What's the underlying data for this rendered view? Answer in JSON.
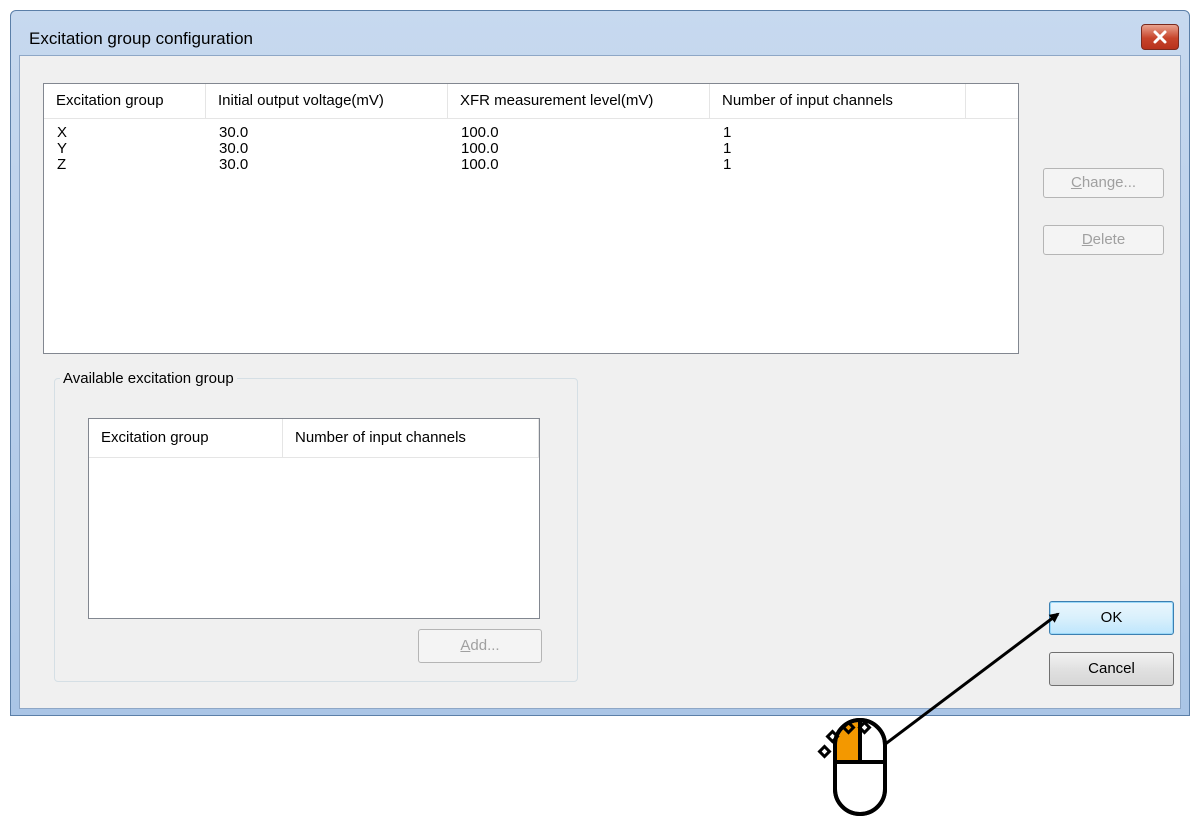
{
  "window": {
    "title": "Excitation group configuration"
  },
  "config_list": {
    "columns": [
      "Excitation group",
      "Initial output voltage(mV)",
      "XFR measurement level(mV)",
      "Number of input channels"
    ],
    "rows": [
      [
        "X",
        "30.0",
        "100.0",
        "1"
      ],
      [
        "Y",
        "30.0",
        "100.0",
        "1"
      ],
      [
        "Z",
        "30.0",
        "100.0",
        "1"
      ]
    ]
  },
  "buttons": {
    "change": {
      "mnemonic": "C",
      "rest": "hange..."
    },
    "delete": {
      "mnemonic": "D",
      "rest": "elete"
    },
    "add": {
      "mnemonic": "A",
      "rest": "dd..."
    },
    "ok": "OK",
    "cancel": "Cancel"
  },
  "available": {
    "legend": "Available excitation group",
    "columns": [
      "Excitation group",
      "Number of input channels"
    ],
    "rows": []
  },
  "annotation": {
    "icon": "mouse-left-click-icon",
    "accent_color": "#f39800",
    "arrow_color": "#000000"
  }
}
